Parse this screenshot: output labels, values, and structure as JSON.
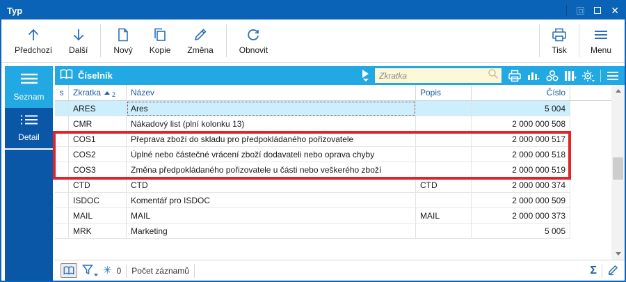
{
  "titlebar": {
    "title": "Typ"
  },
  "toolbar": {
    "prev_label": "Předchozí",
    "next_label": "Další",
    "new_label": "Nový",
    "copy_label": "Kopie",
    "change_label": "Změna",
    "refresh_label": "Obnovit",
    "print_label": "Tisk",
    "menu_label": "Menu"
  },
  "sidebar": {
    "items": [
      {
        "label": "Seznam",
        "active": true
      },
      {
        "label": "Detail",
        "active": false
      }
    ]
  },
  "panel": {
    "title": "Číselník",
    "search_placeholder": "Zkratka"
  },
  "table": {
    "headers": {
      "s": "s",
      "zkratka": "Zkratka",
      "sort_order": "2",
      "nazev": "Název",
      "popis": "Popis",
      "cislo": "Číslo"
    },
    "rows": [
      {
        "s": "",
        "zkratka": "ARES",
        "nazev": "Ares",
        "popis": "",
        "cislo": "5 004",
        "selected": true
      },
      {
        "s": "",
        "zkratka": "CMR",
        "nazev": "Nákadový list (plní kolonku 13)",
        "popis": "",
        "cislo": "2 000 000 508"
      },
      {
        "s": "",
        "zkratka": "COS1",
        "nazev": "Přeprava zboží do skladu pro předpokládaného pořizovatele",
        "popis": "",
        "cislo": "2 000 000 517"
      },
      {
        "s": "",
        "zkratka": "COS2",
        "nazev": "Úplné nebo částečné vrácení zboží dodavateli nebo oprava chyby",
        "popis": "",
        "cislo": "2 000 000 518"
      },
      {
        "s": "",
        "zkratka": "COS3",
        "nazev": "Změna předpokládaného pořizovatele u části nebo veškerého zboží",
        "popis": "",
        "cislo": "2 000 000 519"
      },
      {
        "s": "",
        "zkratka": "CTD",
        "nazev": "CTD",
        "popis": "CTD",
        "cislo": "2 000 000 374"
      },
      {
        "s": "",
        "zkratka": "ISDOC",
        "nazev": "Komentář pro ISDOC",
        "popis": "",
        "cislo": "2 000 000 509"
      },
      {
        "s": "",
        "zkratka": "MAIL",
        "nazev": "MAIL",
        "popis": "MAIL",
        "cislo": "2 000 000 373"
      },
      {
        "s": "",
        "zkratka": "MRK",
        "nazev": "Marketing",
        "popis": "",
        "cislo": "5 005"
      }
    ]
  },
  "statusbar": {
    "frozen_count": "0",
    "records_label": "Počet záznamů"
  },
  "colors": {
    "titlebar": "#0a63b6",
    "accent_light": "#22a8e2",
    "sidebar_dark": "#0b57a7",
    "selection": "#cdeefc",
    "search_bg": "#fdf8d8",
    "annotation_red": "#e1242a",
    "icon_blue": "#2a6fb8",
    "header_text": "#1d5c9f"
  }
}
